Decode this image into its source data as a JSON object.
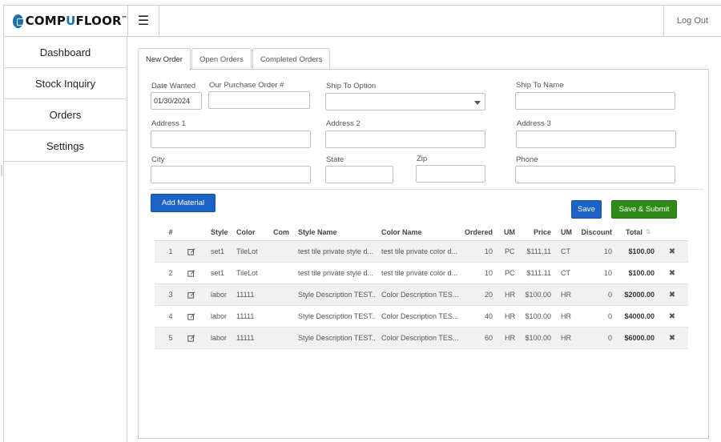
{
  "header": {
    "logo_pre": "COMP",
    "logo_u": "U",
    "logo_post": "FLOOR",
    "logo_tm": "™",
    "menu_icon": "☰",
    "logout": "Log Out"
  },
  "sidebar": {
    "items": [
      {
        "label": "Dashboard"
      },
      {
        "label": "Stock Inquiry"
      },
      {
        "label": "Orders"
      },
      {
        "label": "Settings"
      }
    ]
  },
  "tabs": [
    {
      "label": "New Order",
      "active": true
    },
    {
      "label": "Open Orders",
      "active": false
    },
    {
      "label": "Completed Orders",
      "active": false
    }
  ],
  "form": {
    "date_wanted": {
      "label": "Date Wanted",
      "value": "01/30/2024"
    },
    "po_number": {
      "label": "Our Purchase Order #",
      "value": ""
    },
    "ship_to_option": {
      "label": "Ship To Option",
      "value": ""
    },
    "ship_to_name": {
      "label": "Ship To Name",
      "value": ""
    },
    "address1": {
      "label": "Address 1",
      "value": ""
    },
    "address2": {
      "label": "Address 2",
      "value": ""
    },
    "address3": {
      "label": "Address 3",
      "value": ""
    },
    "city": {
      "label": "City",
      "value": ""
    },
    "state": {
      "label": "State",
      "value": ""
    },
    "zip": {
      "label": "Zip",
      "value": ""
    },
    "phone": {
      "label": "Phone",
      "value": ""
    }
  },
  "buttons": {
    "add_material": "Add Material",
    "save": "Save",
    "save_submit": "Save & Submit"
  },
  "table": {
    "headers": {
      "num": "#",
      "style": "Style",
      "color": "Color",
      "com": "Com",
      "style_name": "Style Name",
      "color_name": "Color Name",
      "ordered": "Ordered",
      "um": "UM",
      "price": "Price",
      "um2": "UM",
      "discount": "Discount",
      "total": "Total",
      "sort_icon": "⇅"
    },
    "rows": [
      {
        "num": "1",
        "style": "set1",
        "color": "TileLot",
        "com": "",
        "style_name": "test tile private style d...",
        "color_name": "test tile private color d...",
        "ordered": "10",
        "um": "PC",
        "price": "$111.11",
        "um2": "CT",
        "discount": "10",
        "total": "$100.00"
      },
      {
        "num": "2",
        "style": "set1",
        "color": "TileLot",
        "com": "",
        "style_name": "test tile private style d...",
        "color_name": "test tile private color d...",
        "ordered": "10",
        "um": "PC",
        "price": "$111.11",
        "um2": "CT",
        "discount": "10",
        "total": "$100.00"
      },
      {
        "num": "3",
        "style": "labor",
        "color": "11111",
        "com": "",
        "style_name": "Style Description TEST...",
        "color_name": "Color Description TES...",
        "ordered": "20",
        "um": "HR",
        "price": "$100.00",
        "um2": "HR",
        "discount": "0",
        "total": "$2000.00"
      },
      {
        "num": "4",
        "style": "labor",
        "color": "11111",
        "com": "",
        "style_name": "Style Description TEST...",
        "color_name": "Color Description TES...",
        "ordered": "40",
        "um": "HR",
        "price": "$100.00",
        "um2": "HR",
        "discount": "0",
        "total": "$4000.00"
      },
      {
        "num": "5",
        "style": "labor",
        "color": "11111",
        "com": "",
        "style_name": "Style Description TEST...",
        "color_name": "Color Description TES...",
        "ordered": "60",
        "um": "HR",
        "price": "$100.00",
        "um2": "HR",
        "discount": "0",
        "total": "$6000.00"
      }
    ],
    "remove_glyph": "✖"
  }
}
